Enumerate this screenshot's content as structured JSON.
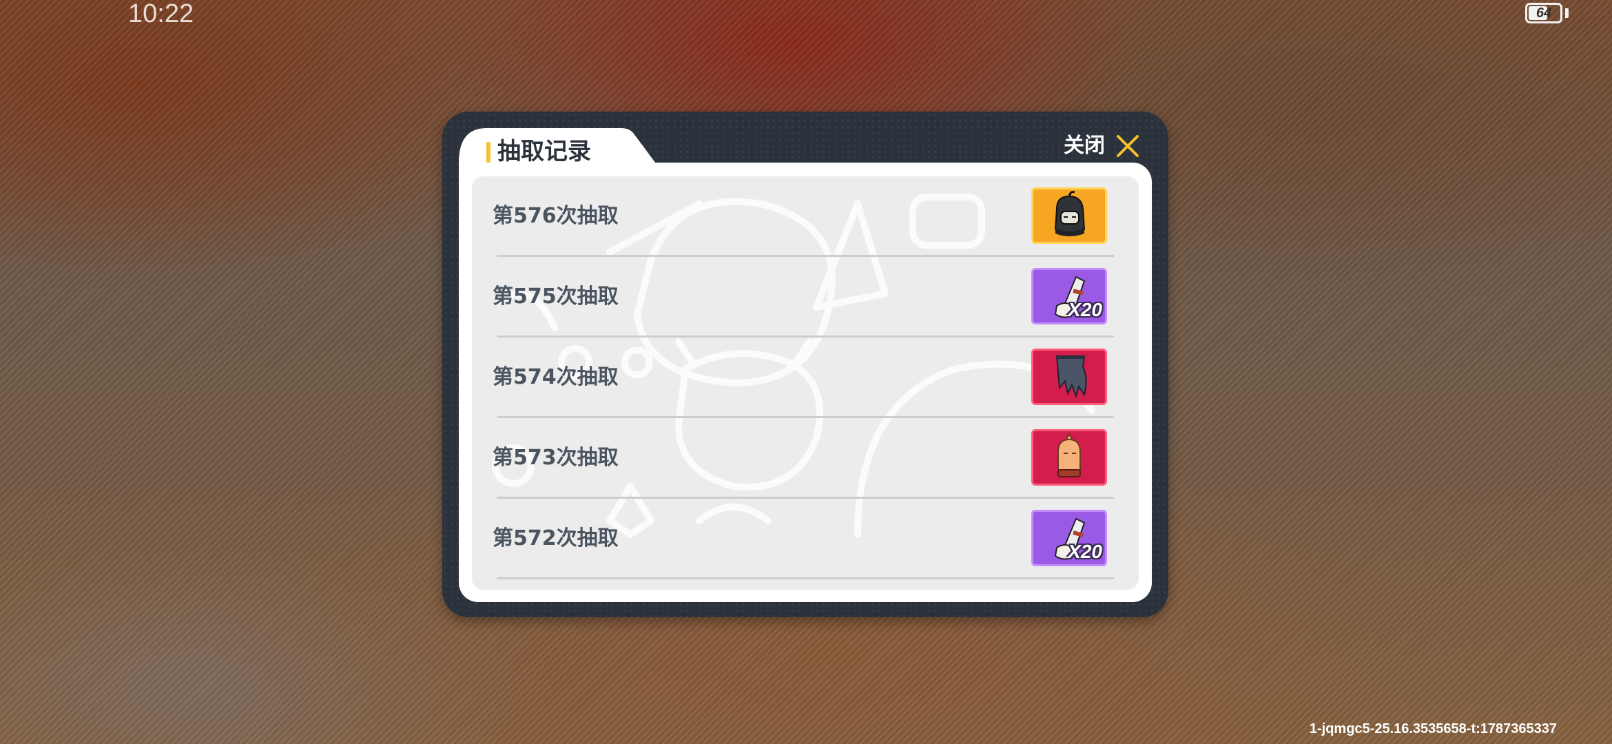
{
  "status_bar": {
    "time": "10:22",
    "battery_level": "64"
  },
  "build_id": "1-jqmgc5-25.16.3535658-t:1787365337",
  "modal": {
    "title": "抽取记录",
    "close_label": "关闭",
    "colors": {
      "accent": "#f6c12a",
      "frame": "#2b323b",
      "text": "#4b5560"
    },
    "records": [
      {
        "label": "第576次抽取",
        "item_icon": "hooded-head-icon",
        "rarity": "gold",
        "quantity": ""
      },
      {
        "label": "第575次抽取",
        "item_icon": "scroll-fragment-icon",
        "rarity": "purple",
        "quantity": "X20"
      },
      {
        "label": "第574次抽取",
        "item_icon": "dark-cape-icon",
        "rarity": "red",
        "quantity": ""
      },
      {
        "label": "第573次抽取",
        "item_icon": "bald-head-icon",
        "rarity": "red",
        "quantity": ""
      },
      {
        "label": "第572次抽取",
        "item_icon": "scroll-fragment-icon",
        "rarity": "purple",
        "quantity": "X20"
      }
    ]
  }
}
